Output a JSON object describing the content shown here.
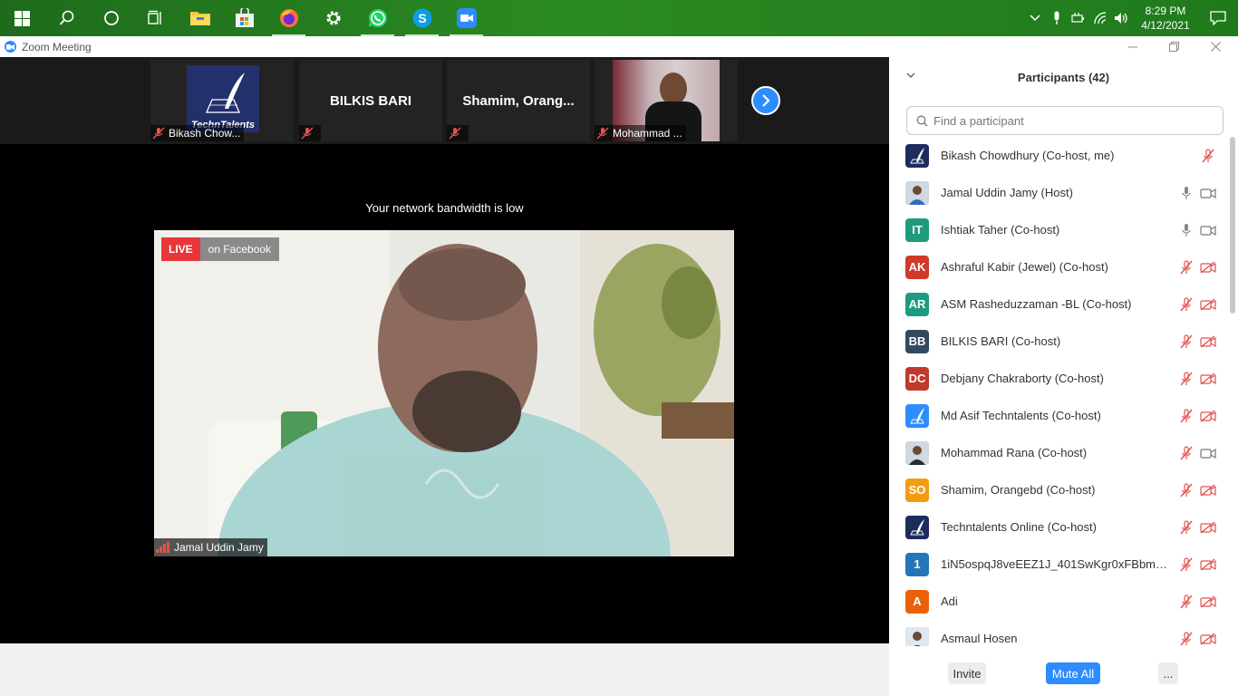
{
  "taskbar": {
    "clock_time": "8:29 PM",
    "clock_date": "4/12/2021"
  },
  "window": {
    "title": "Zoom Meeting"
  },
  "strip": {
    "tiles": [
      {
        "name": "Bikash Chow...",
        "logo_text": "TechnTalents"
      },
      {
        "name": "",
        "big": "BILKIS BARI"
      },
      {
        "name": "",
        "big": "Shamim,  Orang..."
      },
      {
        "name": "Mohammad ..."
      }
    ]
  },
  "notice": "Your network bandwidth is low",
  "video": {
    "live_label": "LIVE",
    "live_platform": "on Facebook",
    "speaker": "Jamal Uddin Jamy"
  },
  "panel": {
    "title": "Participants (42)",
    "search_placeholder": "Find a participant",
    "participants": [
      {
        "name": "Bikash Chowdhury (Co-host, me)",
        "initials": "",
        "avatar": "logo",
        "color": "#1c2c5e"
      },
      {
        "name": "Jamal Uddin Jamy (Host)",
        "initials": "",
        "avatar": "photo",
        "color": "#3d8be0"
      },
      {
        "name": "Ishtiak Taher (Co-host)",
        "initials": "IT",
        "avatar": "initials",
        "color": "#1e9b7e"
      },
      {
        "name": "Ashraful Kabir (Jewel) (Co-host)",
        "initials": "AK",
        "avatar": "initials",
        "color": "#d0392b"
      },
      {
        "name": "ASM Rasheduzzaman -BL (Co-host)",
        "initials": "AR",
        "avatar": "initials",
        "color": "#1e9b7e"
      },
      {
        "name": "BILKIS BARI (Co-host)",
        "initials": "BB",
        "avatar": "initials",
        "color": "#34495e"
      },
      {
        "name": "Debjany Chakraborty (Co-host)",
        "initials": "DC",
        "avatar": "initials",
        "color": "#c0392b"
      },
      {
        "name": "Md Asif Techntalents (Co-host)",
        "initials": "",
        "avatar": "logo2",
        "color": "#2d8cff"
      },
      {
        "name": "Mohammad Rana (Co-host)",
        "initials": "",
        "avatar": "photo2",
        "color": "#8a8a8a"
      },
      {
        "name": "Shamim, Orangebd (Co-host)",
        "initials": "SO",
        "avatar": "initials",
        "color": "#f39c12"
      },
      {
        "name": "Techntalents Online (Co-host)",
        "initials": "",
        "avatar": "logo",
        "color": "#1c2c5e"
      },
      {
        "name": "1iN5ospqJ8veEEZ1J_401SwKgr0xFBbmRyb...",
        "initials": "1",
        "avatar": "initials",
        "color": "#2476b8"
      },
      {
        "name": "Adi",
        "initials": "A",
        "avatar": "initials",
        "color": "#e8620b"
      },
      {
        "name": "Asmaul Hosen",
        "initials": "",
        "avatar": "photo3",
        "color": "#3a5a8a"
      }
    ],
    "invite_label": "Invite",
    "mute_all_label": "Mute All",
    "more_label": "..."
  },
  "colors": {
    "zoom_blue": "#2d8cff",
    "live_red": "#e8363a",
    "muted_red": "#e0524f",
    "taskbar_green": "#1f7a1c"
  }
}
